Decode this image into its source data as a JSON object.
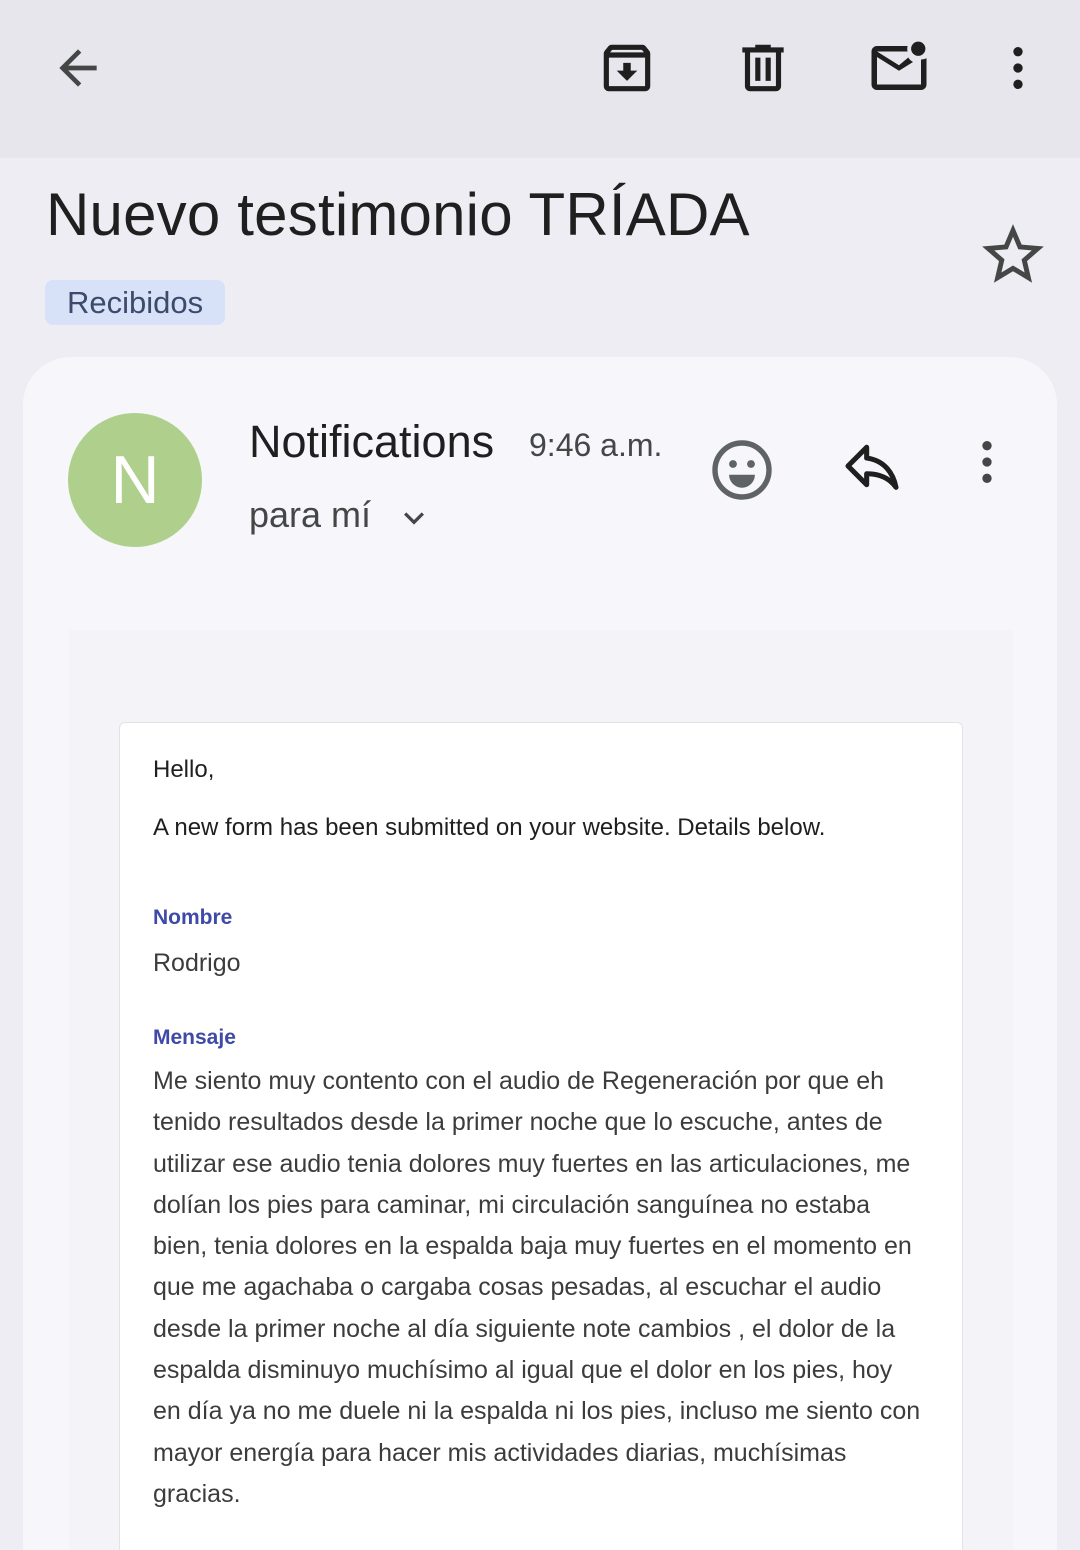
{
  "toolbar": {
    "back_icon": "arrow-back-icon",
    "archive_icon": "archive-icon",
    "delete_icon": "trash-icon",
    "unread_icon": "mark-unread-icon",
    "more_icon": "more-vert-icon"
  },
  "email": {
    "subject": "Nuevo testimonio TRÍADA",
    "label": "Recibidos",
    "starred": false,
    "sender": {
      "initial": "N",
      "name": "Notifications",
      "avatar_color": "#afd08c"
    },
    "time": "9:46 a.m.",
    "recipient": "para mí",
    "body": {
      "greeting": "Hello,",
      "intro": "A new form has been submitted on your website. Details below.",
      "fields": [
        {
          "label": "Nombre",
          "value": "Rodrigo"
        },
        {
          "label": "Mensaje",
          "value": "Me siento muy contento con el audio de Regeneración por que eh tenido resultados desde la primer noche que lo escuche, antes de utilizar ese audio tenia dolores muy fuertes en las articulaciones, me dolían los pies para caminar, mi circulación sanguínea no estaba bien, tenia dolores en la espalda baja muy fuertes en el momento en que me agachaba o cargaba cosas pesadas, al escuchar el audio desde la primer noche al día siguiente note cambios , el dolor de la espalda disminuyo muchísimo al igual que el dolor en los pies, hoy en día ya no me duele ni la espalda ni los pies, incluso me siento con mayor energía para hacer mis actividades diarias, muchísimas gracias."
        }
      ]
    }
  },
  "colors": {
    "accent_label": "#3f4aa8",
    "chip_bg": "#d7e1f8",
    "toolbar_bg": "#e7e6ec"
  }
}
